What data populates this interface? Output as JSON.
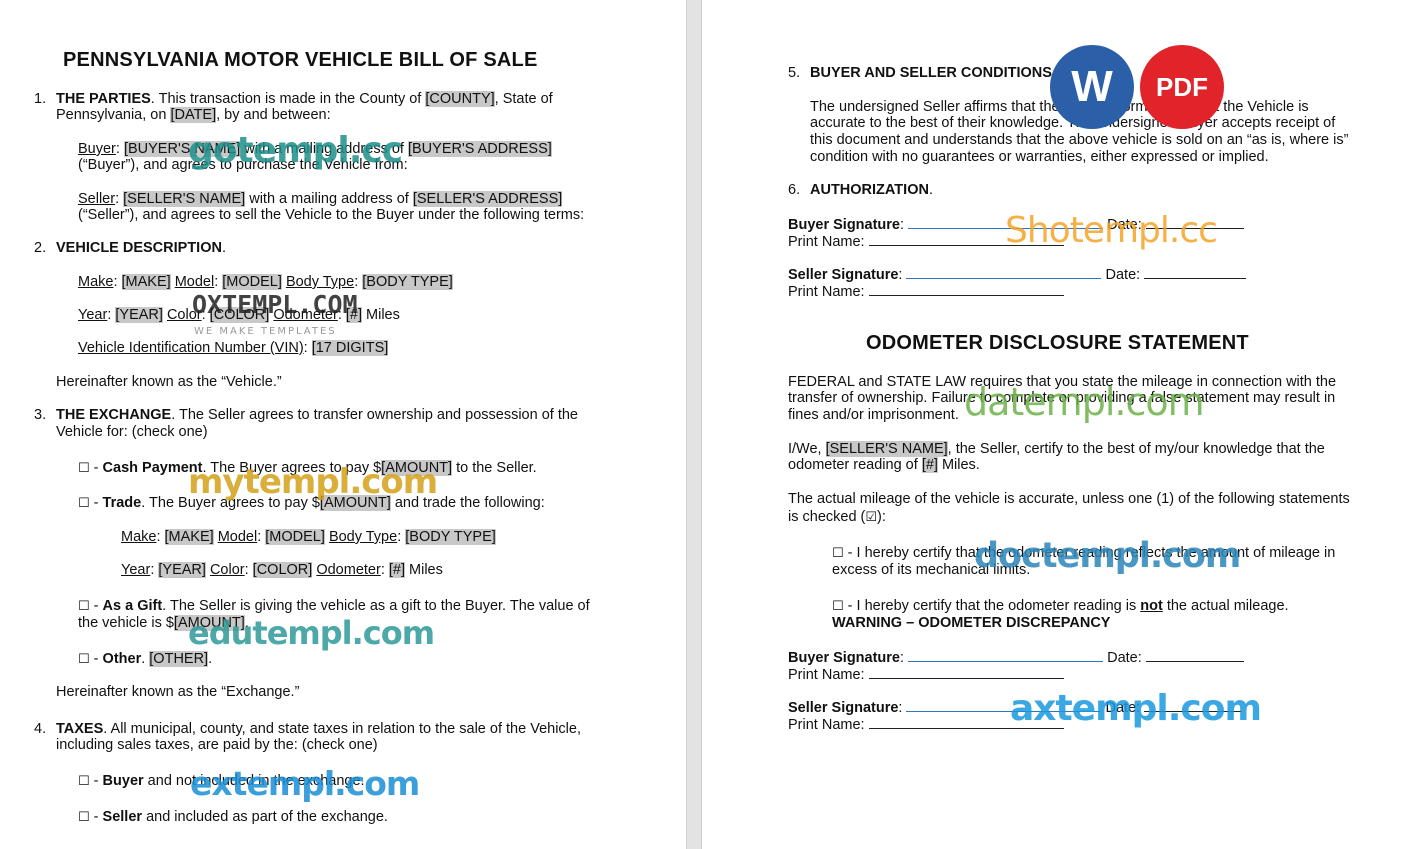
{
  "left": {
    "title": "PENNSYLVANIA MOTOR VEHICLE BILL OF SALE",
    "s1": {
      "num": "1.",
      "heading": "THE PARTIES",
      "t1": ". This transaction is made in the County of ",
      "county": "[COUNTY]",
      "t2": ", State of",
      "t3": "Pennsylvania, on ",
      "date": "[DATE]",
      "t4": ", by and between:",
      "buyer_label": "Buyer",
      "buyer_name": "[BUYER'S NAME]",
      "buyer_t1": " with a mailing address of ",
      "buyer_address": "[BUYER'S ADDRESS]",
      "buyer_t2": "(“Buyer”), and agrees to purchase the Vehicle from:",
      "seller_label": "Seller",
      "seller_name": "[SELLER'S NAME]",
      "seller_t1": " with a mailing address of ",
      "seller_address": "[SELLER'S ADDRESS]",
      "seller_t2": "(“Seller”), and agrees to sell the Vehicle to the Buyer under the following terms:"
    },
    "s2": {
      "num": "2.",
      "heading": "VEHICLE DESCRIPTION",
      "make_label": "Make",
      "make": "[MAKE]",
      "model_label": "Model",
      "model": "[MODEL]",
      "body_label": "Body Type",
      "body": "[BODY TYPE]",
      "year_label": "Year",
      "year": "[YEAR]",
      "color_label": "Color",
      "color": "[COLOR]",
      "odo_label": "Odometer",
      "odo": "[#]",
      "miles": " Miles",
      "vin_label": "Vehicle Identification Number (VIN)",
      "vin": "[17 DIGITS]",
      "known": "Hereinafter known as the “Vehicle.”"
    },
    "s3": {
      "num": "3.",
      "heading": "THE EXCHANGE",
      "t1": ". The Seller agrees to transfer ownership and possession of the",
      "t2": "Vehicle for: (check one)",
      "checkbox": "☐",
      "cash_label": "Cash Payment",
      "cash_t": ". The Buyer agrees to pay $",
      "amount": "[AMOUNT]",
      "cash_t2": " to the Seller.",
      "trade_label": "Trade",
      "trade_t": ". The Buyer agrees to pay $",
      "trade_t2": " and trade the following:",
      "gift_label": "As a Gift",
      "gift_t1": ". The Seller is giving the vehicle as a gift to the Buyer. The value of",
      "gift_t2": "the vehicle is $",
      "other_label": "Other",
      "other": "[OTHER]",
      "known": "Hereinafter known as the “Exchange.”"
    },
    "s4": {
      "num": "4.",
      "heading": "TAXES",
      "t1": ". All municipal, county, and state taxes in relation to the sale of the Vehicle,",
      "t2": "including sales taxes, are paid by the: (check one)",
      "buyer_label": "Buyer",
      "buyer_t": " and not included in the exchange.",
      "seller_label": "Seller",
      "seller_t": " and included as part of the exchange."
    }
  },
  "right": {
    "s5": {
      "num": "5.",
      "heading": "BUYER AND SELLER CONDITIONS",
      "l1": "The undersigned Seller affirms that the above information about the Vehicle is",
      "l2": "accurate to the best of their knowledge. The undersigned Buyer accepts receipt of",
      "l3": "this document and understands that the above vehicle is sold on an “as is, where is”",
      "l4": "condition with no guarantees or warranties, either expressed or implied."
    },
    "s6": {
      "num": "6.",
      "heading": "AUTHORIZATION",
      "buyer_sig": "Buyer Signature",
      "seller_sig": "Seller Signature",
      "date_label": "Date:",
      "print_name": "Print Name:"
    },
    "odometer": {
      "title": "ODOMETER DISCLOSURE STATEMENT",
      "p1_l1": "FEDERAL and STATE LAW requires that you state the mileage in connection with the",
      "p1_l2": "transfer of ownership. Failure to complete or providing a false statement may result in",
      "p1_l3": "fines and/or imprisonment.",
      "p2_t1": "I/We, ",
      "seller_name": "[SELLER'S NAME]",
      "p2_t2": ", the Seller, certify to the best of my/our knowledge that the",
      "p2_t3": "odometer reading of ",
      "reading": "[#]",
      "p2_t4": " Miles.",
      "p3_l1": "The actual mileage of the vehicle is accurate, unless one (1) of the following statements",
      "p3_l2": "is checked (",
      "checked_box": "☑",
      "p3_l2_end": "):",
      "opt1_l1": " - I hereby certify that the odometer reading reflects the amount of mileage in",
      "opt1_l2": "excess of its mechanical limits.",
      "opt2_t1": " - I hereby certify that the odometer reading is ",
      "opt2_not": "not",
      "opt2_t2": " the actual mileage.",
      "warning": "WARNING – ODOMETER DISCREPANCY",
      "buyer_sig": "Buyer Signature",
      "seller_sig": "Seller Signature",
      "date_label": "Date:",
      "print_name": "Print Name:"
    }
  },
  "badges": {
    "word": "W",
    "pdf": "PDF",
    "word_color": "#2b5fa8",
    "pdf_color": "#e0242a"
  },
  "watermarks": {
    "gotempl": "gotempl.cc",
    "oxtempl": "OXTEMPL.COM",
    "oxtempl_sub": "WE MAKE TEMPLATES",
    "mytempl": "mytempl.com",
    "edutempl": "edutempl.com",
    "extempl": "extempl.com",
    "shotempl": "Shotempl.cc",
    "datempl": "datempl.com",
    "doctempl": "doctempl.com",
    "axtempl": "axtempl.com"
  }
}
